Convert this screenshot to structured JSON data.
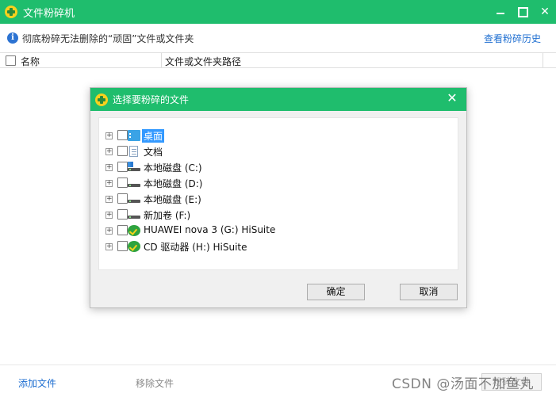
{
  "window": {
    "title": "文件粉碎机",
    "close_glyph": "✕"
  },
  "infobar": {
    "text": "彻底粉碎无法删除的“顽固”文件或文件夹",
    "history_link": "查看粉碎历史"
  },
  "list": {
    "col_name": "名称",
    "col_path": "文件或文件夹路径"
  },
  "bottombar": {
    "add_label": "添加文件",
    "remove_label": "移除文件",
    "ghost_label": "粉碎文件"
  },
  "watermark": "CSDN @汤面不加鱼丸",
  "dialog": {
    "title": "选择要粉碎的文件",
    "close_glyph": "✕",
    "ok_label": "确定",
    "cancel_label": "取消",
    "tree": [
      {
        "label": "桌面",
        "icon": "desktop-icon",
        "selected": true
      },
      {
        "label": "文档",
        "icon": "document-icon",
        "selected": false
      },
      {
        "label": "本地磁盘 (C:)",
        "icon": "system-drive-icon",
        "selected": false
      },
      {
        "label": "本地磁盘 (D:)",
        "icon": "drive-icon",
        "selected": false
      },
      {
        "label": "本地磁盘 (E:)",
        "icon": "drive-icon",
        "selected": false
      },
      {
        "label": "新加卷 (F:)",
        "icon": "drive-icon",
        "selected": false
      },
      {
        "label": "HUAWEI nova 3 (G:) HiSuite",
        "icon": "hisuite-icon",
        "selected": false
      },
      {
        "label": "CD 驱动器 (H:) HiSuite",
        "icon": "hisuite-icon",
        "selected": false
      }
    ]
  },
  "colors": {
    "accent_green": "#1fbd6d",
    "link_blue": "#1f6fd1",
    "selection_blue": "#3399ff"
  }
}
